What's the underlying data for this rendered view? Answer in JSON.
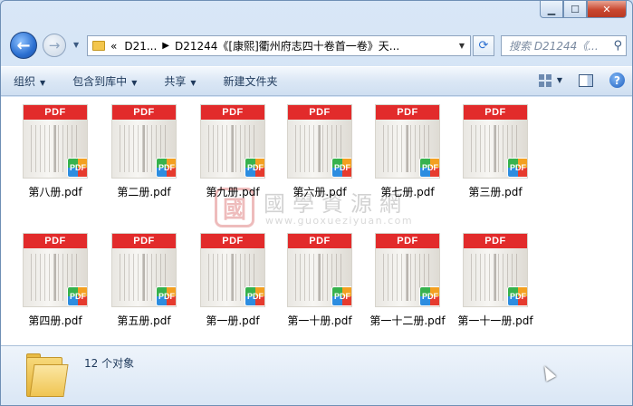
{
  "window": {
    "caption_buttons": {
      "minimize": "▁",
      "maximize": "☐",
      "close": "✕"
    }
  },
  "address_bar": {
    "prefix": "«",
    "crumbs": [
      "D21...",
      "D21244《[康熙]衢州府志四十卷首一卷》天..."
    ],
    "search_placeholder": "搜索 D21244《..."
  },
  "toolbar": {
    "organize": "组织",
    "include_in_library": "包含到库中",
    "share": "共享",
    "new_folder": "新建文件夹"
  },
  "files": [
    {
      "name": "第八册.pdf",
      "band": "PDF",
      "badge": "PDF"
    },
    {
      "name": "第二册.pdf",
      "band": "PDF",
      "badge": "PDF"
    },
    {
      "name": "第九册.pdf",
      "band": "PDF",
      "badge": "PDF"
    },
    {
      "name": "第六册.pdf",
      "band": "PDF",
      "badge": "PDF"
    },
    {
      "name": "第七册.pdf",
      "band": "PDF",
      "badge": "PDF"
    },
    {
      "name": "第三册.pdf",
      "band": "PDF",
      "badge": "PDF"
    },
    {
      "name": "第四册.pdf",
      "band": "PDF",
      "badge": "PDF"
    },
    {
      "name": "第五册.pdf",
      "band": "PDF",
      "badge": "PDF"
    },
    {
      "name": "第一册.pdf",
      "band": "PDF",
      "badge": "PDF"
    },
    {
      "name": "第一十册.pdf",
      "band": "PDF",
      "badge": "PDF"
    },
    {
      "name": "第一十二册.pdf",
      "band": "PDF",
      "badge": "PDF"
    },
    {
      "name": "第一十一册.pdf",
      "band": "PDF",
      "badge": "PDF"
    }
  ],
  "watermark": {
    "seal_char": "國",
    "title": "國學資源網",
    "url": "www.guoxueziyuan.com"
  },
  "status": {
    "count": "12 个对象"
  },
  "colors": {
    "pdf_band": "#e22b2b",
    "window_frame": "#c9dcf2"
  }
}
